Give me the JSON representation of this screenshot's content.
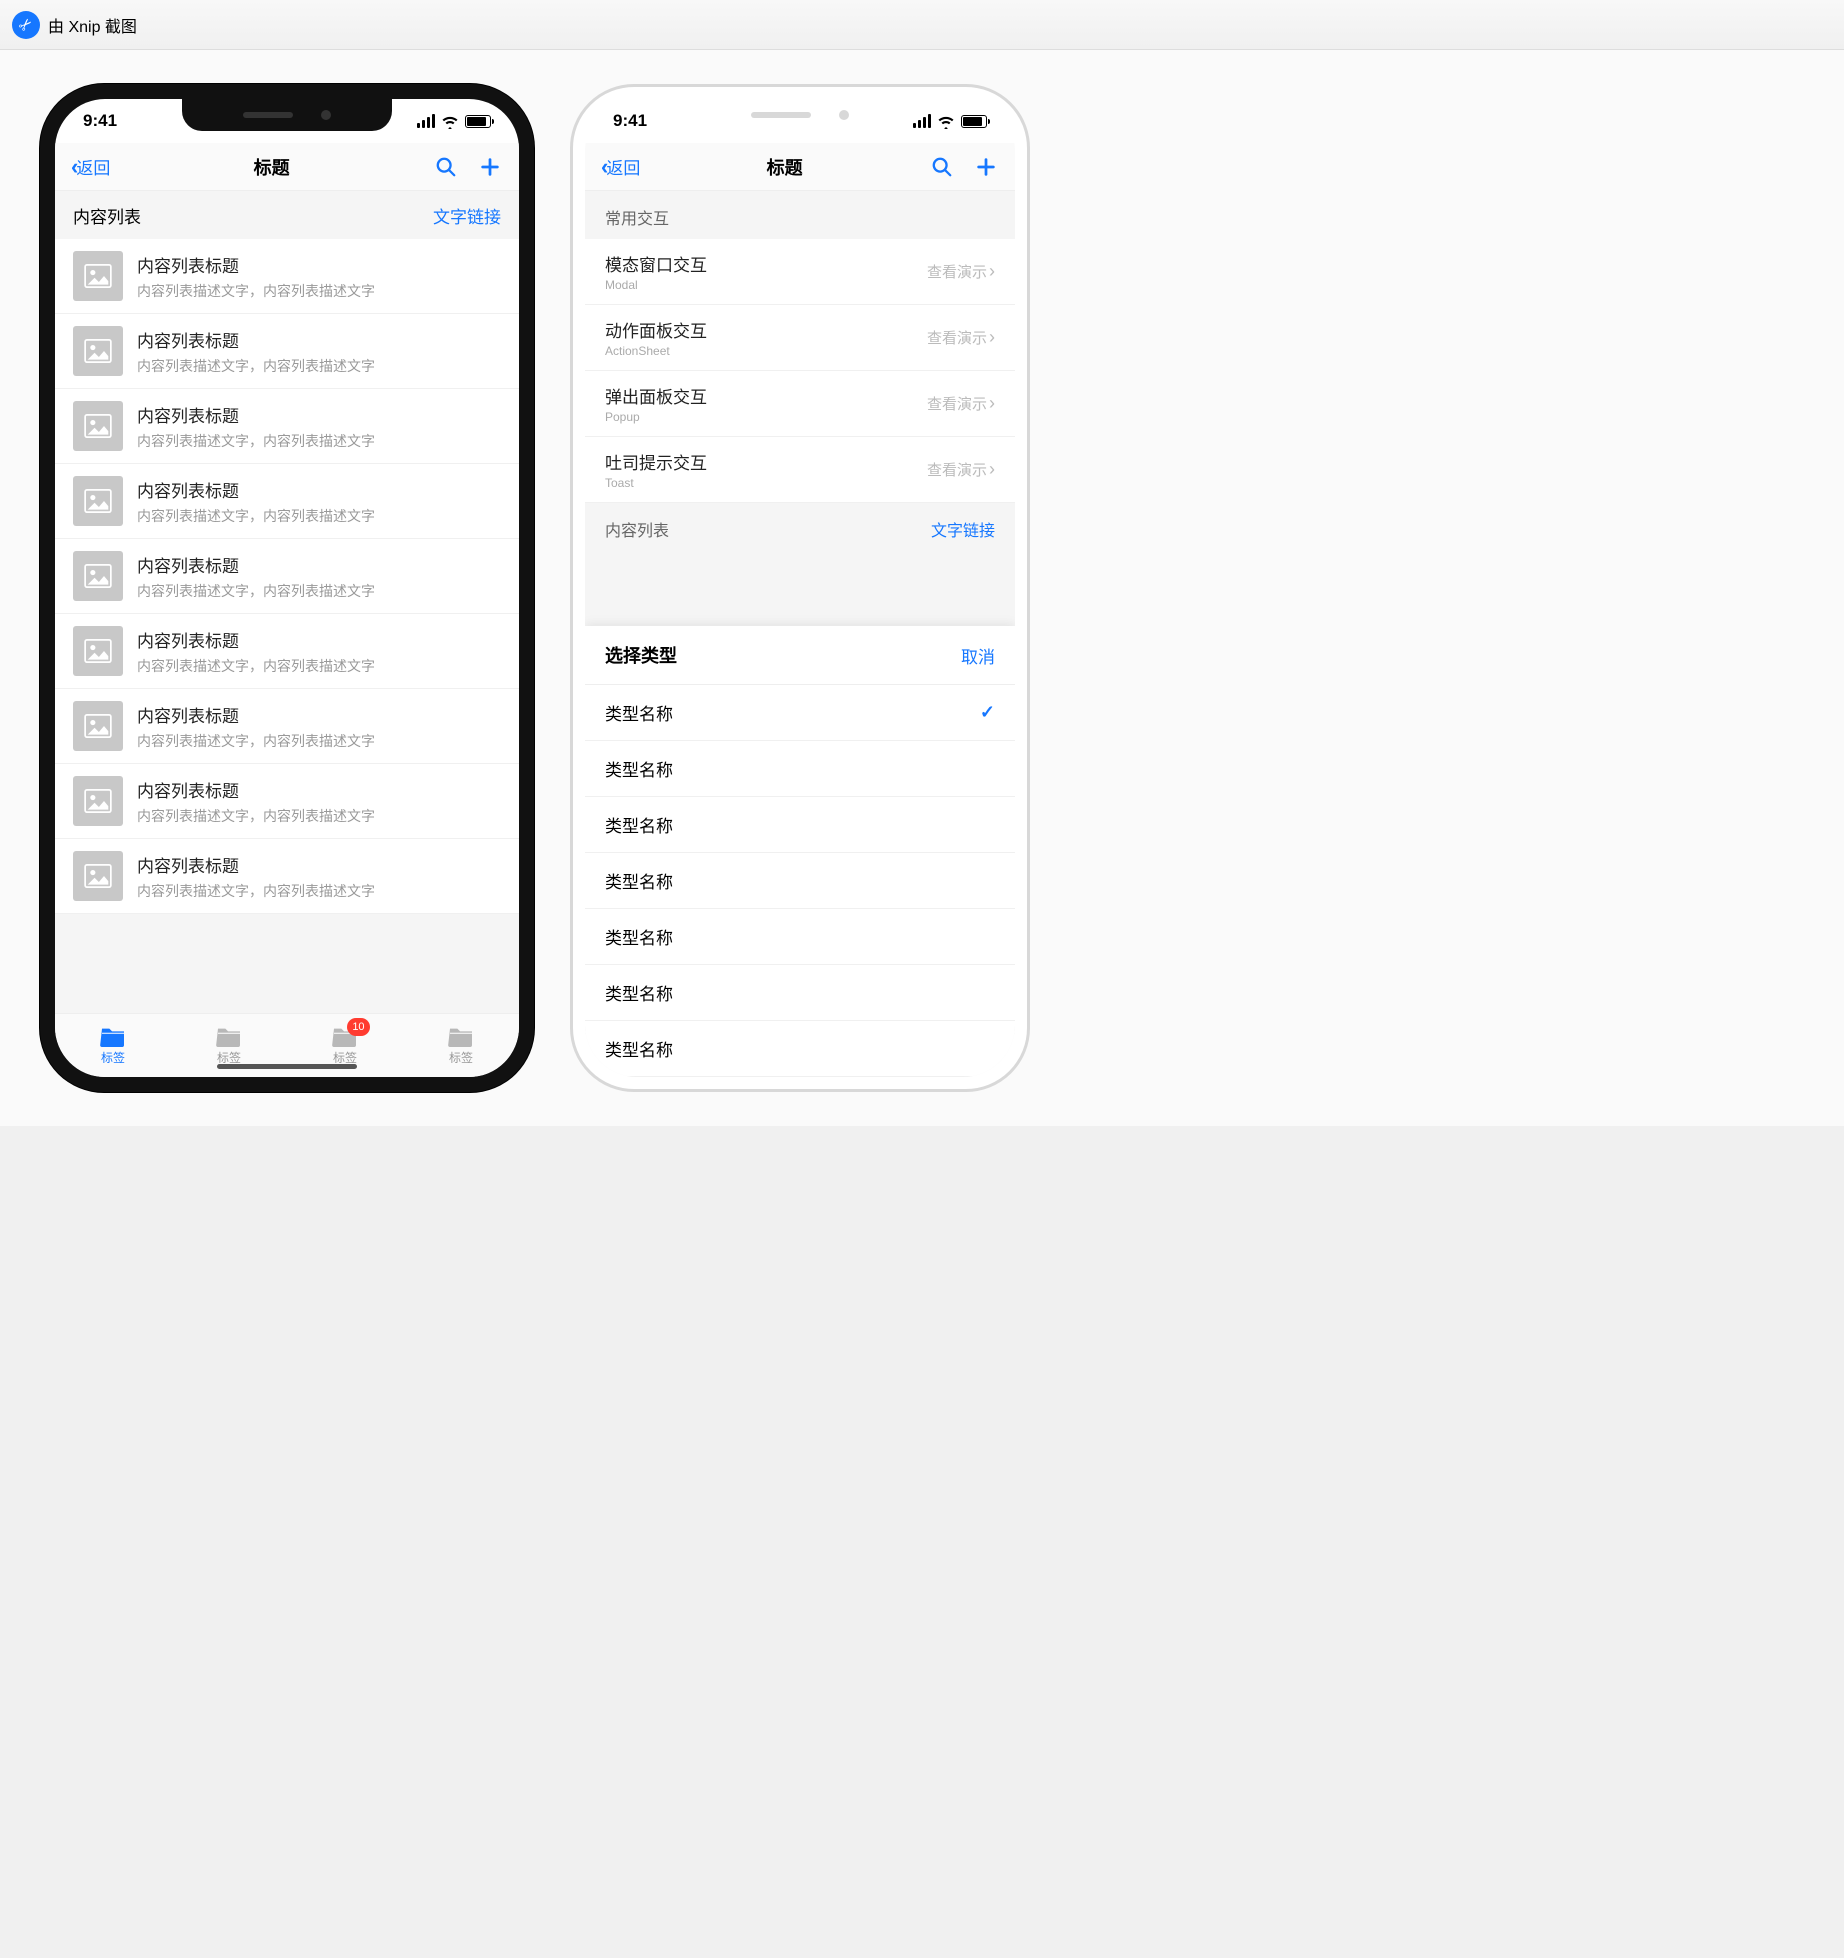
{
  "banner": {
    "text": "由 Xnip 截图"
  },
  "status": {
    "time": "9:41"
  },
  "nav": {
    "back": "返回",
    "title": "标题"
  },
  "left": {
    "section_header": "内容列表",
    "section_link": "文字链接",
    "item_title": "内容列表标题",
    "item_desc": "内容列表描述文字，内容列表描述文字",
    "tab_label": "标签",
    "badge": "10"
  },
  "right": {
    "section1_header": "常用交互",
    "action_label": "查看演示",
    "rows": [
      {
        "title": "模态窗口交互",
        "sub": "Modal"
      },
      {
        "title": "动作面板交互",
        "sub": "ActionSheet"
      },
      {
        "title": "弹出面板交互",
        "sub": "Popup"
      },
      {
        "title": "吐司提示交互",
        "sub": "Toast"
      }
    ],
    "section2_header": "内容列表",
    "section2_link": "文字链接",
    "sheet": {
      "title": "选择类型",
      "cancel": "取消",
      "option": "类型名称"
    }
  }
}
